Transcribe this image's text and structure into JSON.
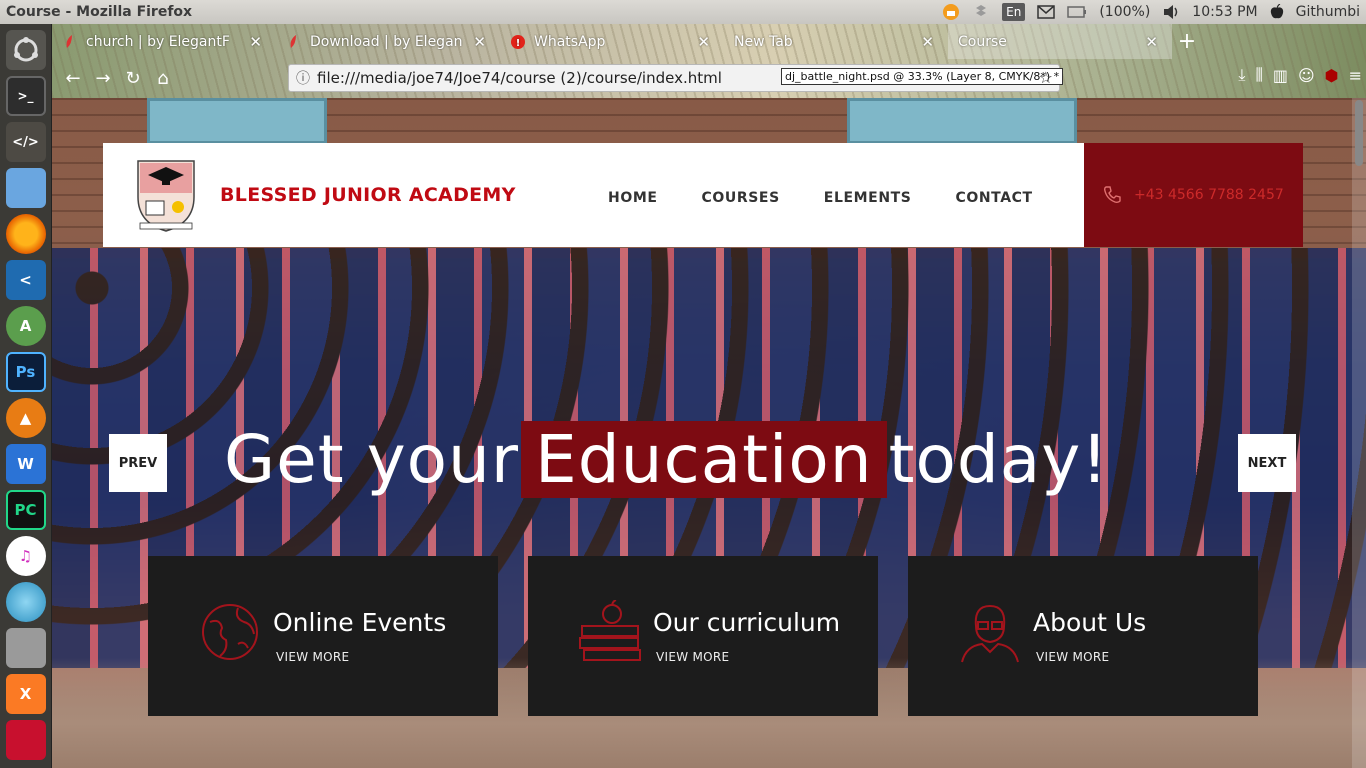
{
  "panel": {
    "window_title": "Course - Mozilla Firefox",
    "keyboard": "En",
    "battery": "(100%)",
    "time": "10:53 PM",
    "user": "Githumbi"
  },
  "launcher": {
    "items": [
      "Ubuntu Dash",
      "Terminal",
      "Sublime Text",
      "Files",
      "Firefox",
      "VS Code",
      "Android Studio",
      "Photoshop",
      "VLC",
      "WPS Writer",
      "PyCharm",
      "iTunes",
      "Disk",
      "Storage",
      "XAMPP",
      "Installer"
    ]
  },
  "browser": {
    "tabs": [
      {
        "label": "church | by ElegantF",
        "icon": "elegant-icon",
        "active": false
      },
      {
        "label": "Download | by Elegan",
        "icon": "elegant-icon",
        "active": false
      },
      {
        "label": "WhatsApp",
        "icon": "whatsapp-icon",
        "active": false
      },
      {
        "label": "New Tab",
        "icon": "",
        "active": false
      },
      {
        "label": "Course",
        "icon": "",
        "active": true
      }
    ],
    "url": "file:///media/joe74/Joe74/course (2)/course/index.html",
    "url_tooltip": "dj_battle_night.psd @ 33.3% (Layer 8, CMYK/8*) *"
  },
  "site": {
    "brand": "BLESSED JUNIOR ACADEMY",
    "menu": [
      "HOME",
      "COURSES",
      "ELEMENTS",
      "CONTACT"
    ],
    "phone": "+43 4566 7788 2457",
    "headline_pre": "Get your",
    "headline_highlight": "Education",
    "headline_post": "today!",
    "prev": "PREV",
    "next": "NEXT",
    "cards": [
      {
        "title": "Online Events",
        "more": "VIEW MORE",
        "icon": "globe-icon"
      },
      {
        "title": "Our curriculum",
        "more": "VIEW MORE",
        "icon": "books-apple-icon"
      },
      {
        "title": "About Us",
        "more": "VIEW MORE",
        "icon": "teacher-icon"
      }
    ]
  },
  "colors": {
    "accent": "#7d0b12",
    "brand_red": "#c00a13",
    "card_bg": "#1c1c1c"
  }
}
